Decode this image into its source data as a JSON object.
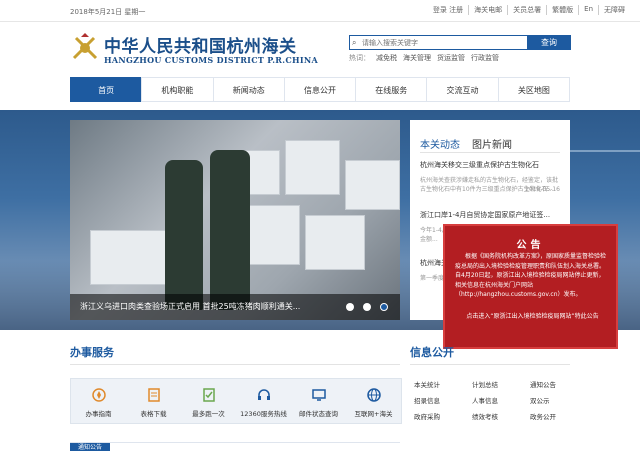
{
  "topbar": {
    "date": "2018年5月21日  星期一",
    "links": [
      "登录 注册",
      "海关电邮",
      "关员总署",
      "繁體版",
      "En",
      "无障碍"
    ]
  },
  "header": {
    "title_cn": "中华人民共和国杭州海关",
    "title_en": "HANGZHOU CUSTOMS DISTRICT P.R.CHINA"
  },
  "search": {
    "placeholder": "请输入搜索关键字",
    "button": "查询",
    "hot_label": "热词：",
    "hot_words": [
      "减免税",
      "海关管理",
      "货运监管",
      "行政监管"
    ]
  },
  "nav": [
    "首页",
    "机构职能",
    "新闻动态",
    "信息公开",
    "在线服务",
    "交流互动",
    "关区地图"
  ],
  "slider": {
    "caption": "浙江义乌进口肉类查验场正式启用 首批25吨冻猪肉顺利通关..."
  },
  "news": {
    "tabs": [
      "本关动态",
      "图片新闻"
    ],
    "items": [
      {
        "title": "杭州海关移交三级重点保护古生物化石",
        "desc": "杭州海关查获涉嫌走私的古生物化石，经鉴定，该批古生物化石中有10件为三级重点保护古生物化石...",
        "date": "2018-05-16"
      },
      {
        "title": "浙江口岸1-4月自贸协定国家原产地证签...",
        "desc": "今年1-4月，浙江口岸自贸协定国家原产地证书签证金额...",
        "date": ""
      },
      {
        "title": "杭州海关...",
        "desc": "第一季度...",
        "date": ""
      }
    ]
  },
  "notice": {
    "heading": "公告",
    "body": "根据《国务院机构改革方案》，原国家质量监督检验检疫总局的出入境检验检疫管理职责和队伍划入海关总署。自4月20日起，原浙江出入境检验检疫局网站停止更新，相关信息在杭州海关门户网站（http://hangzhou.customs.gov.cn）发布。",
    "link": "点击进入“原浙江出入境检验检疫局网站”特此公告"
  },
  "services": {
    "title": "办事服务",
    "items": [
      {
        "label": "办事指南",
        "icon": "compass-icon"
      },
      {
        "label": "表格下载",
        "icon": "document-icon"
      },
      {
        "label": "最多跑一次",
        "icon": "checklist-icon"
      },
      {
        "label": "12360服务热线",
        "icon": "headset-icon"
      },
      {
        "label": "邮件状态查询",
        "icon": "monitor-icon"
      },
      {
        "label": "互联网+海关",
        "icon": "globe-icon"
      }
    ]
  },
  "info": {
    "title": "信息公开",
    "items": [
      "本关统计",
      "计划总结",
      "通知公告",
      "招录信息",
      "人事信息",
      "双公示",
      "政府采购",
      "绩效考核",
      "政务公开"
    ]
  },
  "notice_tab": "通知公告",
  "colors": {
    "brand": "#1d5aa0",
    "notice_red": "#b31e22"
  }
}
